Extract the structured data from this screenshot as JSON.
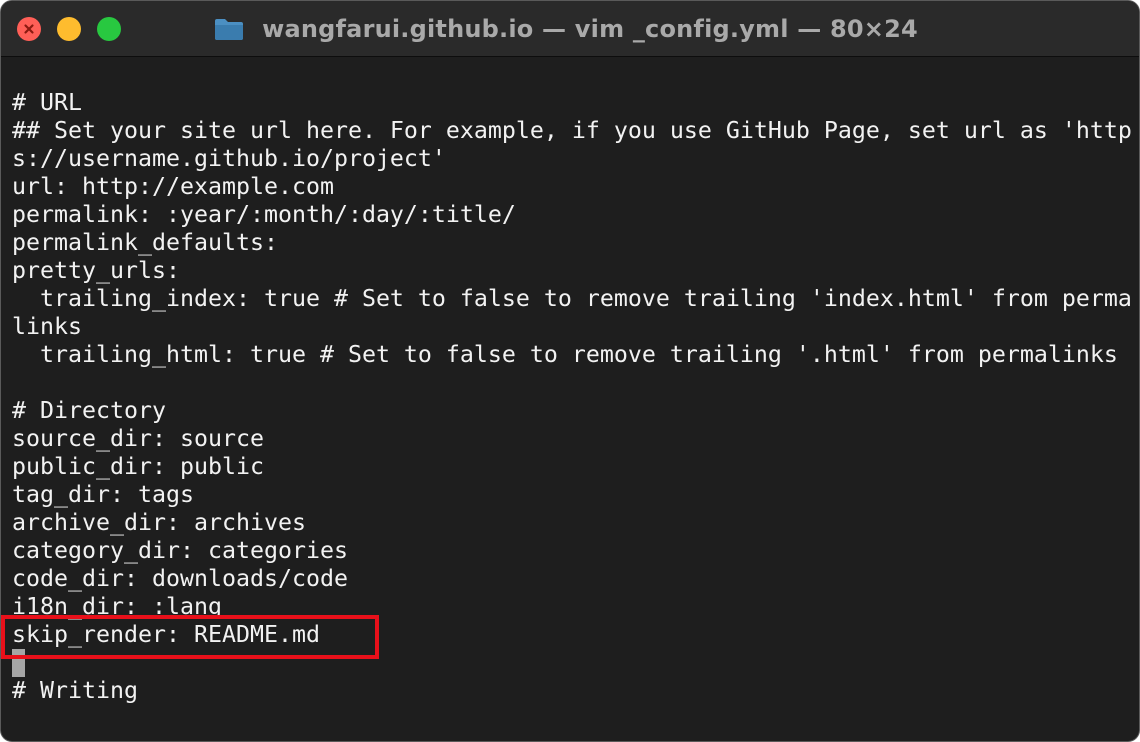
{
  "window": {
    "title": "wangfarui.github.io — vim _config.yml — 80×24",
    "traffic_lights": {
      "close": "#ff5f57",
      "minimize": "#febc2e",
      "maximize": "#28c840"
    },
    "folder_icon": "folder-icon"
  },
  "editor": {
    "lines": [
      "# URL",
      "## Set your site url here. For example, if you use GitHub Page, set url as 'http",
      "s://username.github.io/project'",
      "url: http://example.com",
      "permalink: :year/:month/:day/:title/",
      "permalink_defaults:",
      "pretty_urls:",
      "  trailing_index: true # Set to false to remove trailing 'index.html' from perma",
      "links",
      "  trailing_html: true # Set to false to remove trailing '.html' from permalinks",
      "",
      "# Directory",
      "source_dir: source",
      "public_dir: public",
      "tag_dir: tags",
      "archive_dir: archives",
      "category_dir: categories",
      "code_dir: downloads/code",
      "i18n_dir: :lang",
      "skip_render: README.md",
      "",
      "# Writing"
    ],
    "highlight_color": "#e8101a"
  }
}
